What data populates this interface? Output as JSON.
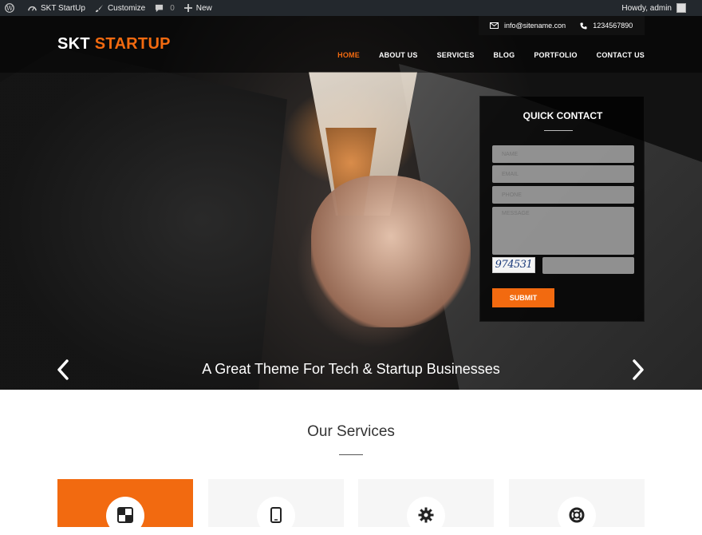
{
  "adminbar": {
    "site_name": "SKT StartUp",
    "customize": "Customize",
    "comments_count": "0",
    "new_label": "New",
    "howdy": "Howdy, admin"
  },
  "header": {
    "logo_part1": "SKT ",
    "logo_part2": "STARTUP",
    "email": "info@sitename.con",
    "phone": "1234567890",
    "nav": [
      "HOME",
      "ABOUT US",
      "SERVICES",
      "BLOG",
      "PORTFOLIO",
      "CONTACT US"
    ],
    "active_nav": "HOME"
  },
  "quick_contact": {
    "title": "QUICK CONTACT",
    "name_placeholder": "NAME",
    "email_placeholder": "EMAIL",
    "phone_placeholder": "PHONE",
    "message_placeholder": "MESSAGE",
    "captcha_text": "974531",
    "submit_label": "SUBMIT"
  },
  "slider": {
    "caption": "A Great Theme For Tech & Startup Businesses"
  },
  "services": {
    "title": "Our Services",
    "cards": [
      {
        "icon": "layout-icon",
        "active": true
      },
      {
        "icon": "mobile-icon",
        "active": false
      },
      {
        "icon": "gear-icon",
        "active": false
      },
      {
        "icon": "lifebuoy-icon",
        "active": false
      }
    ]
  },
  "colors": {
    "accent": "#f26a10",
    "adminbar_bg": "#23282d"
  }
}
